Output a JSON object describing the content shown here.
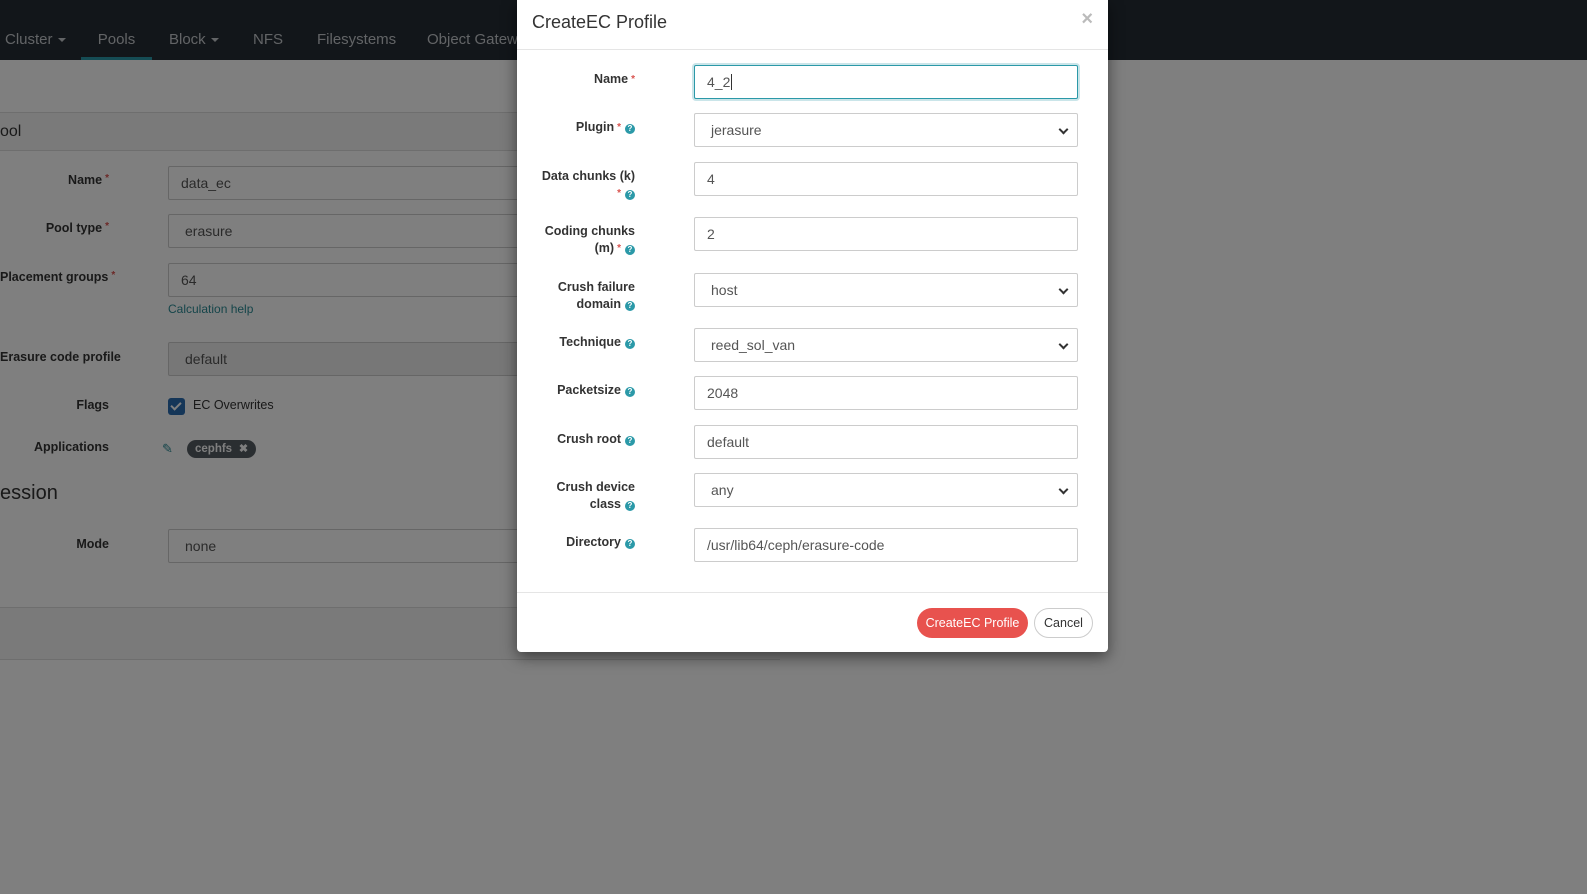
{
  "nav": {
    "items": [
      {
        "label": "Cluster",
        "dropdown": true
      },
      {
        "label": "Pools",
        "dropdown": false,
        "active": true
      },
      {
        "label": "Block",
        "dropdown": true
      },
      {
        "label": "NFS",
        "dropdown": false
      },
      {
        "label": "Filesystems",
        "dropdown": false
      },
      {
        "label": "Object Gatew",
        "dropdown": false
      }
    ]
  },
  "pool_form": {
    "heading": "ool",
    "name_label": "Name",
    "name_value": "data_ec",
    "pool_type_label": "Pool type",
    "pool_type_value": "erasure",
    "pg_label": "Placement groups",
    "pg_value": "64",
    "calc_help": "Calculation help",
    "ec_profile_label": "Erasure code profile",
    "ec_profile_value": "default",
    "flags_label": "Flags",
    "ec_overwrites_label": "EC Overwrites",
    "applications_label": "Applications",
    "app_tag": "cephfs",
    "compression_heading": "ession",
    "mode_label": "Mode",
    "mode_value": "none"
  },
  "modal": {
    "title": "CreateEC Profile",
    "close": "×",
    "fields": {
      "name": {
        "label": "Name",
        "value": "4_2"
      },
      "plugin": {
        "label": "Plugin",
        "value": "jerasure"
      },
      "data_chunks": {
        "label_1": "Data chunks (k)",
        "value": "4"
      },
      "coding_chunks": {
        "label_1": "Coding chunks",
        "label_2": "(m)",
        "value": "2"
      },
      "crush_failure_domain": {
        "label_1": "Crush failure",
        "label_2": "domain",
        "value": "host"
      },
      "technique": {
        "label": "Technique",
        "value": "reed_sol_van"
      },
      "packetsize": {
        "label": "Packetsize",
        "value": "2048"
      },
      "crush_root": {
        "label": "Crush root",
        "value": "default"
      },
      "crush_device_class": {
        "label_1": "Crush device",
        "label_2": "class",
        "value": "any"
      },
      "directory": {
        "label": "Directory",
        "value": "/usr/lib64/ceph/erasure-code"
      }
    },
    "submit_label": "CreateEC Profile",
    "cancel_label": "Cancel"
  },
  "colors": {
    "nav_bg": "#252c34",
    "accent": "#2b99a8",
    "primary_button": "#e8524e",
    "required_marker": "#d9534f"
  }
}
